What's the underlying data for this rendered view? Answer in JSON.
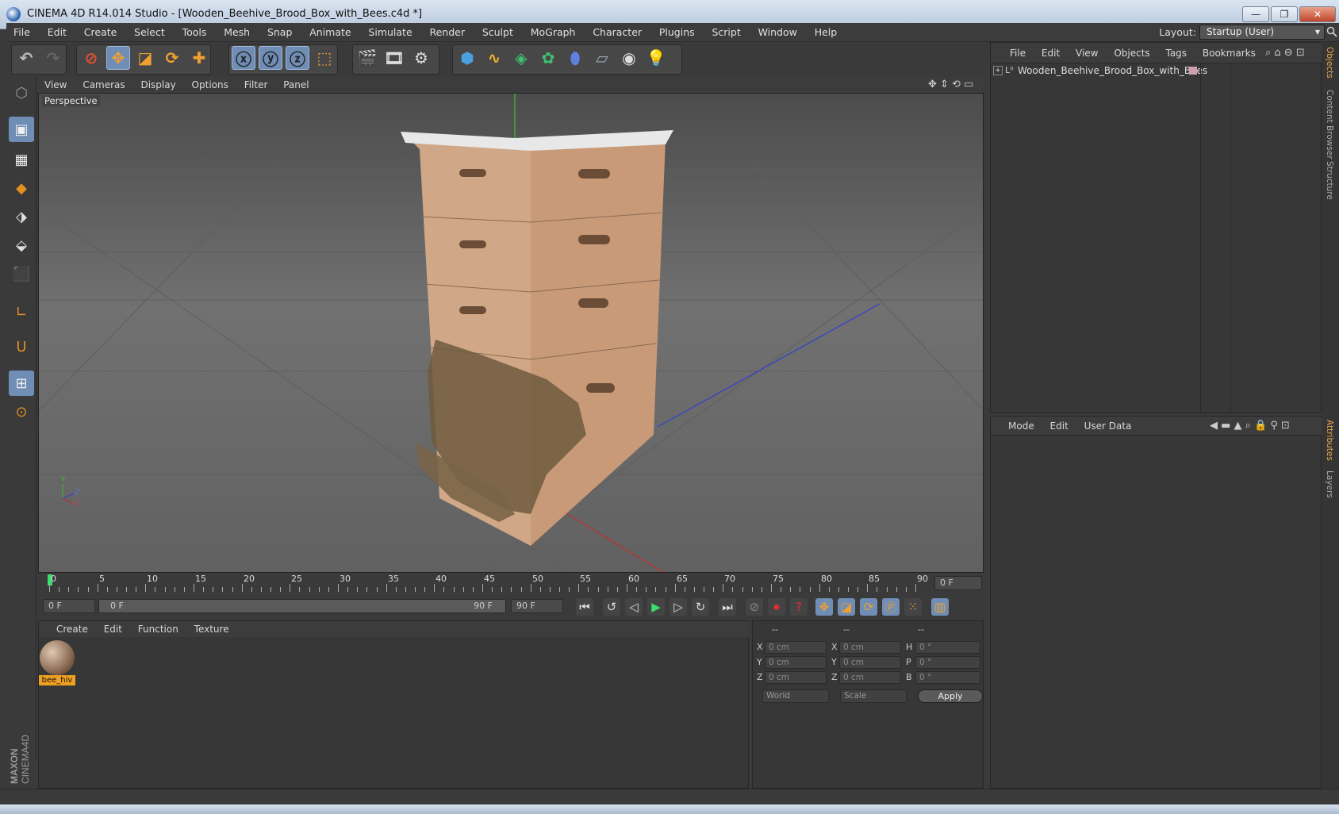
{
  "window": {
    "title": "CINEMA 4D R14.014 Studio - [Wooden_Beehive_Brood_Box_with_Bees.c4d *]",
    "controls": [
      "—",
      "❐",
      "✕"
    ]
  },
  "menubar": {
    "items": [
      "File",
      "Edit",
      "Create",
      "Select",
      "Tools",
      "Mesh",
      "Snap",
      "Animate",
      "Simulate",
      "Render",
      "Sculpt",
      "MoGraph",
      "Character",
      "Plugins",
      "Script",
      "Window",
      "Help"
    ],
    "layout_label": "Layout:",
    "layout_value": "Startup (User)"
  },
  "viewport": {
    "menu": [
      "View",
      "Cameras",
      "Display",
      "Options",
      "Filter",
      "Panel"
    ],
    "label": "Perspective",
    "axis_y": "Y",
    "axis_z": "Z",
    "axis_x": "X"
  },
  "timeline": {
    "ticks": [
      "0",
      "5",
      "10",
      "15",
      "20",
      "25",
      "30",
      "35",
      "40",
      "45",
      "50",
      "55",
      "60",
      "65",
      "70",
      "75",
      "80",
      "85",
      "90"
    ],
    "current_frame": "0 F",
    "start_field": "0 F",
    "range_start": "0 F",
    "range_end": "90 F",
    "end_field": "90 F"
  },
  "material": {
    "menu": [
      "Create",
      "Edit",
      "Function",
      "Texture"
    ],
    "item_label": "bee_hiv"
  },
  "coordinates": {
    "headers": [
      "--",
      "--",
      "--"
    ],
    "rows": [
      {
        "a": "X",
        "av": "0 cm",
        "b": "X",
        "bv": "0 cm",
        "c": "H",
        "cv": "0 °"
      },
      {
        "a": "Y",
        "av": "0 cm",
        "b": "Y",
        "bv": "0 cm",
        "c": "P",
        "cv": "0 °"
      },
      {
        "a": "Z",
        "av": "0 cm",
        "b": "Z",
        "bv": "0 cm",
        "c": "B",
        "cv": "0 °"
      }
    ],
    "mode1": "World",
    "mode2": "Scale",
    "apply": "Apply"
  },
  "objects": {
    "menu": [
      "File",
      "Edit",
      "View",
      "Objects",
      "Tags",
      "Bookmarks"
    ],
    "item": "Wooden_Beehive_Brood_Box_with_Bees"
  },
  "attributes": {
    "menu": [
      "Mode",
      "Edit",
      "User Data"
    ]
  },
  "side_tabs": [
    "Objects",
    "Content Browser",
    "Structure",
    "Attributes",
    "Layers"
  ],
  "brand": "MAXON CINEMA 4D",
  "colors": {
    "accent": "#e6a64a",
    "selected": "#6f8db5",
    "axis_red": "#d43030",
    "axis_green": "#3bbf3b",
    "axis_blue": "#3040d0"
  }
}
